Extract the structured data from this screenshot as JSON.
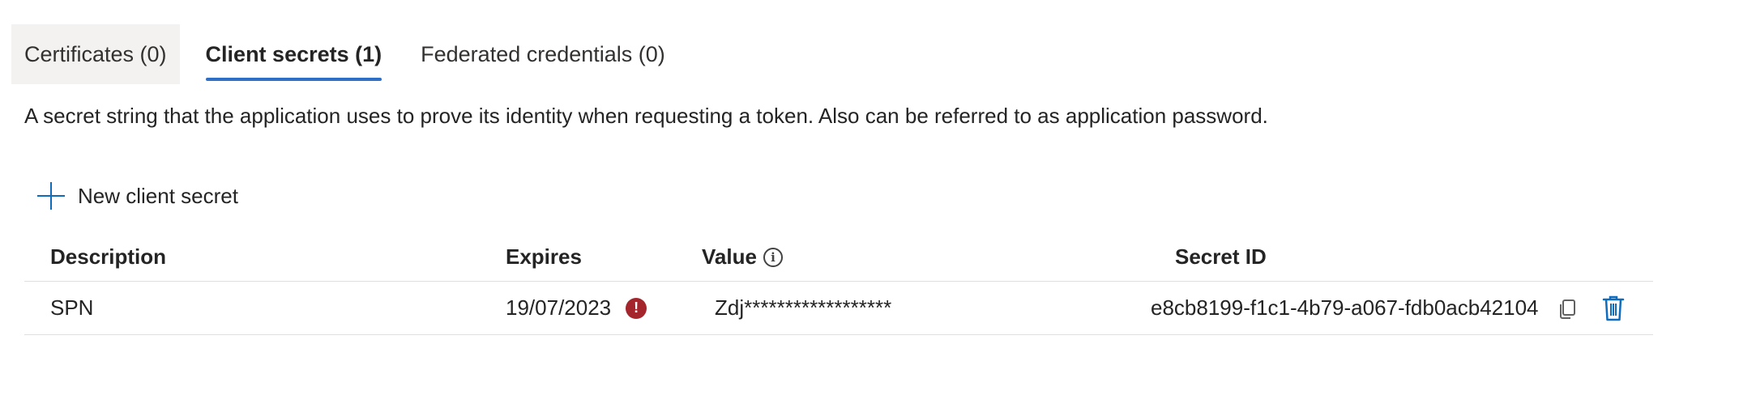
{
  "tabs": [
    {
      "label": "Certificates (0)"
    },
    {
      "label": "Client secrets (1)"
    },
    {
      "label": "Federated credentials (0)"
    }
  ],
  "description": "A secret string that the application uses to prove its identity when requesting a token. Also can be referred to as application password.",
  "toolbar": {
    "new_secret_label": "New client secret"
  },
  "table": {
    "headers": {
      "description": "Description",
      "expires": "Expires",
      "value": "Value",
      "secret_id": "Secret ID"
    },
    "rows": [
      {
        "description": "SPN",
        "expires": "19/07/2023",
        "value": "Zdj******************",
        "secret_id": "e8cb8199-f1c1-4b79-a067-fdb0acb42104"
      }
    ]
  },
  "icons": {
    "add": "plus-icon",
    "info": "info-icon",
    "expired": "error-icon",
    "copy": "copy-icon",
    "delete": "trash-icon"
  },
  "colors": {
    "accent": "#2f6fc6",
    "plus": "#0f6cbd",
    "error": "#a4262c",
    "trash": "#0f6cbd"
  }
}
